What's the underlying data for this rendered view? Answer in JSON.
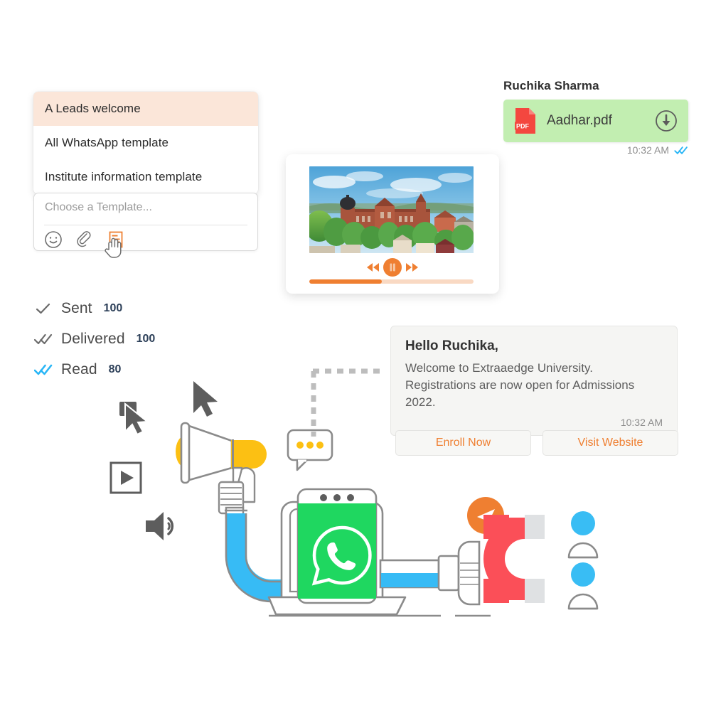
{
  "template_dropdown": {
    "items": [
      {
        "label": "A Leads welcome",
        "selected": true
      },
      {
        "label": "All WhatsApp template",
        "selected": false
      },
      {
        "label": "Institute information template",
        "selected": false
      }
    ]
  },
  "template_input": {
    "placeholder": "Choose a Template...",
    "value": "",
    "icons": [
      "emoji-icon",
      "attachment-icon",
      "template-icon"
    ]
  },
  "stats": {
    "rows": [
      {
        "label": "Sent",
        "value": "100",
        "icon": "single-check-icon",
        "color": "#6b6b6b"
      },
      {
        "label": "Delivered",
        "value": "100",
        "icon": "double-check-icon",
        "color": "#6b6b6b"
      },
      {
        "label": "Read",
        "value": "80",
        "icon": "double-check-icon",
        "color": "#29b6f6"
      }
    ]
  },
  "media_card": {
    "alt": "university-campus-photo",
    "controls": [
      "rewind-icon",
      "pause-icon",
      "forward-icon"
    ],
    "progress_percent": 44,
    "progress_color": "#ef7f31",
    "progress_track_color": "#f9d9c3"
  },
  "pdf_message": {
    "sender": "Ruchika Sharma",
    "file_name": "Aadhar.pdf",
    "file_badge": "PDF",
    "time": "10:32 AM",
    "download_icon": "download-icon",
    "status_icon": "double-check-icon",
    "bubble_color": "#c2eeb1",
    "status_color": "#29b6f6"
  },
  "text_message": {
    "title": "Hello Ruchika,",
    "body": "Welcome to Extraaedge University. Registrations are now open for Admissions 2022.",
    "time": "10:32 AM",
    "buttons": [
      {
        "label": "Enroll Now"
      },
      {
        "label": "Visit Website"
      }
    ],
    "accent_color": "#ef7f31"
  },
  "illustration": {
    "elements": [
      "cursor-arrow-icon",
      "cursor-click-icon",
      "play-button-icon",
      "speaker-icon",
      "megaphone-icon",
      "typing-bubble-icon",
      "dashed-frame-icon",
      "laptop-icon",
      "whatsapp-phone-icon",
      "send-badge-icon",
      "magnet-icon",
      "user-avatar-icon",
      "user-avatar-icon"
    ],
    "colors": {
      "whatsapp_green": "#1fd760",
      "megaphone_yellow": "#fcc013",
      "pipe_blue": "#37bbf5",
      "magnet_red": "#fb4f58",
      "send_orange": "#ef7f31",
      "avatar_blue": "#39bdf4",
      "outline_gray": "#8b8b8b"
    }
  }
}
